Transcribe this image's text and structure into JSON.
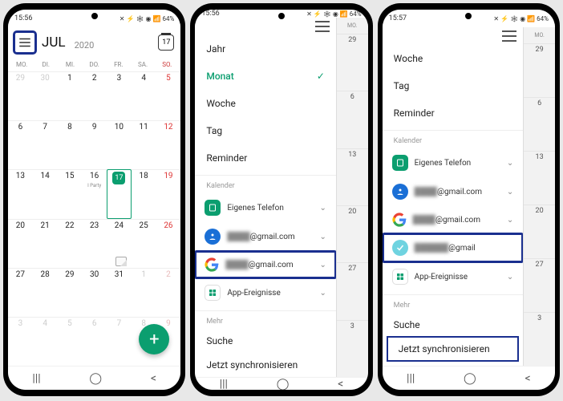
{
  "status": {
    "time1": "15:56",
    "time2": "15:56",
    "time3": "15:57",
    "battery": "64%",
    "icons": "✕ ⚡ 🕸 ◉ 📶"
  },
  "screen1": {
    "month": "JUL",
    "year": "2020",
    "today_badge": "17",
    "weekdays": [
      "MO.",
      "DI.",
      "MI.",
      "DO.",
      "FR.",
      "SA.",
      "SO."
    ],
    "rows": [
      [
        {
          "n": "29",
          "dim": true
        },
        {
          "n": "30",
          "dim": true
        },
        {
          "n": "1"
        },
        {
          "n": "2"
        },
        {
          "n": "3"
        },
        {
          "n": "4"
        },
        {
          "n": "5",
          "sun": true
        }
      ],
      [
        {
          "n": "6"
        },
        {
          "n": "7"
        },
        {
          "n": "8"
        },
        {
          "n": "9"
        },
        {
          "n": "10"
        },
        {
          "n": "11"
        },
        {
          "n": "12",
          "sun": true
        }
      ],
      [
        {
          "n": "13"
        },
        {
          "n": "14"
        },
        {
          "n": "15"
        },
        {
          "n": "16",
          "ev": "I Party"
        },
        {
          "n": "17",
          "today": true
        },
        {
          "n": "18"
        },
        {
          "n": "19",
          "sun": true
        }
      ],
      [
        {
          "n": "20"
        },
        {
          "n": "21"
        },
        {
          "n": "22"
        },
        {
          "n": "23"
        },
        {
          "n": "24",
          "note": true
        },
        {
          "n": "25"
        },
        {
          "n": "26",
          "sun": true
        }
      ],
      [
        {
          "n": "27"
        },
        {
          "n": "28"
        },
        {
          "n": "29"
        },
        {
          "n": "30"
        },
        {
          "n": "31"
        },
        {
          "n": "1",
          "dim": true
        },
        {
          "n": "2",
          "dim": true,
          "sun": true
        }
      ],
      [
        {
          "n": "3",
          "dim": true
        },
        {
          "n": "4",
          "dim": true
        },
        {
          "n": "5",
          "dim": true
        },
        {
          "n": "6",
          "dim": true
        },
        {
          "n": "7",
          "dim": true
        },
        {
          "n": "8",
          "dim": true
        },
        {
          "n": "9",
          "dim": true,
          "sun": true
        }
      ]
    ]
  },
  "drawer": {
    "views": {
      "jahr": "Jahr",
      "monat": "Monat",
      "woche": "Woche",
      "tag": "Tag",
      "reminder": "Reminder"
    },
    "section_kalender": "Kalender",
    "accounts": {
      "phone": "Eigenes Telefon",
      "gmail1_suffix": "@gmail.com",
      "gmail2_suffix": "@gmail.com",
      "gmail3_suffix": "@gmail",
      "app_events": "App-Ereignisse"
    },
    "section_mehr": "Mehr",
    "suche": "Suche",
    "sync": "Jetzt synchronisieren"
  },
  "behind": {
    "head": "MO.",
    "days": [
      "29",
      "6",
      "13",
      "20",
      "27",
      "3"
    ]
  }
}
